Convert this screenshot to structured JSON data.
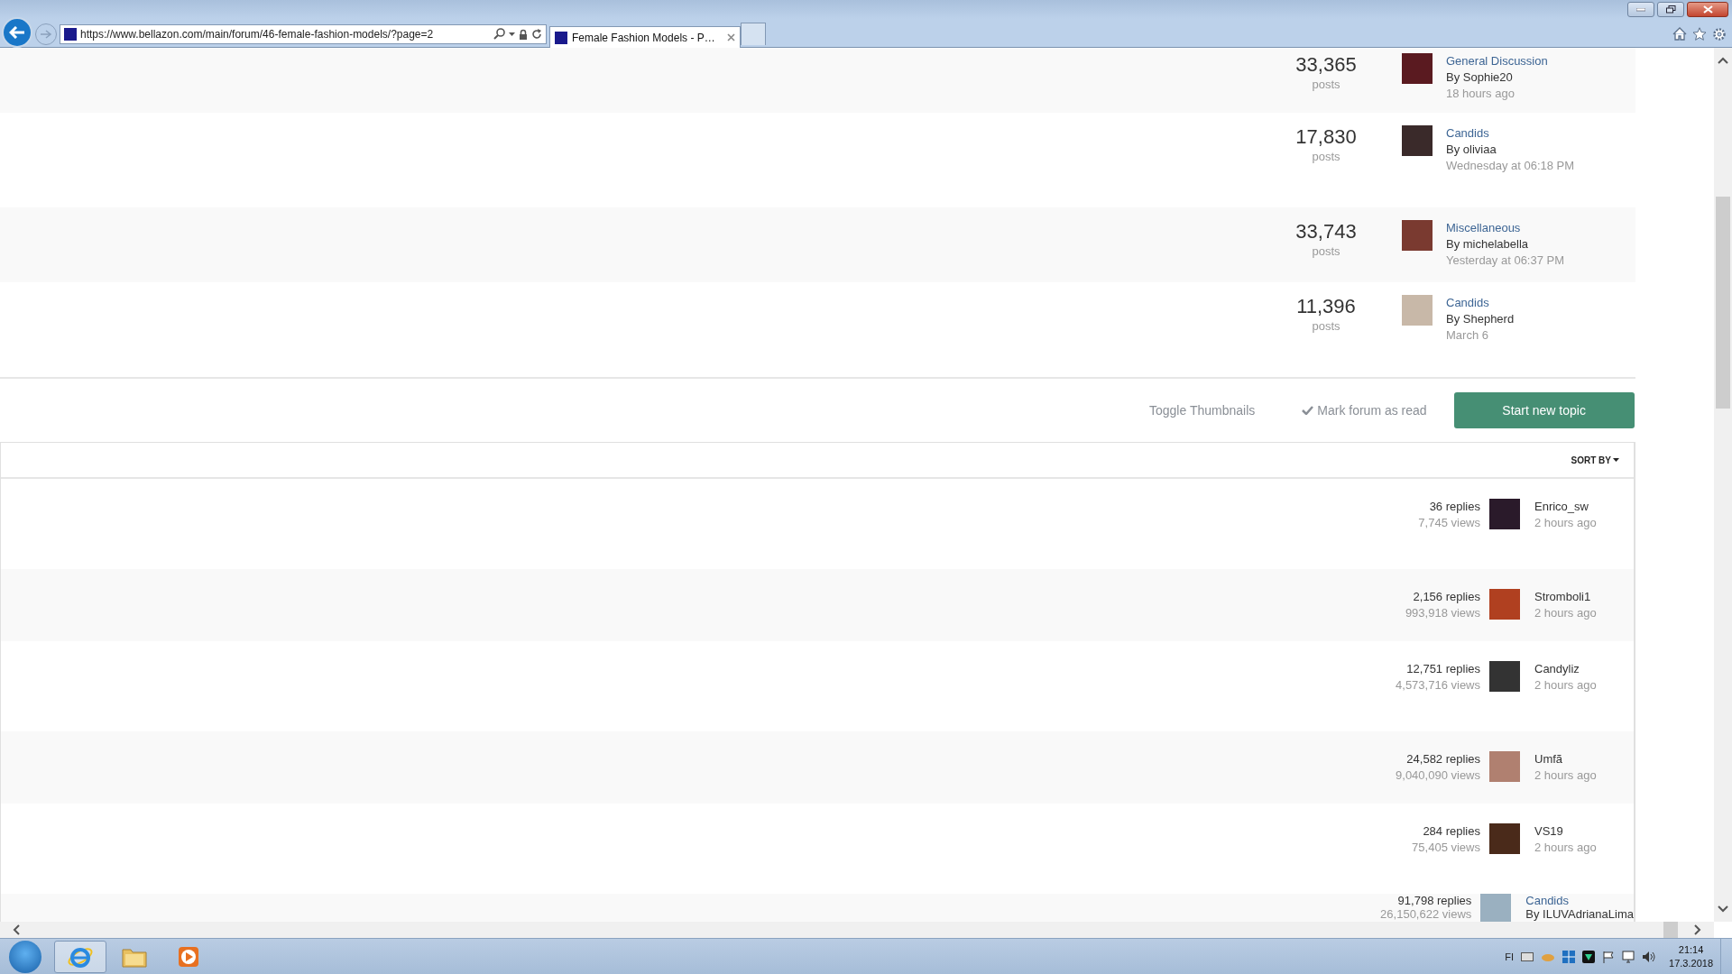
{
  "browser": {
    "url": "https://www.bellazon.com/main/forum/46-female-fashion-models/?page=2",
    "tabs": [
      {
        "title": "Female Fashion Models - P…",
        "selected": true
      }
    ]
  },
  "forums": [
    {
      "posts": "33,365",
      "posts_label": "posts",
      "forum": "General Discussion",
      "by": "By Sophie20",
      "time": "18 hours ago"
    },
    {
      "posts": "17,830",
      "posts_label": "posts",
      "forum": "Candids",
      "by": "By oliviaa",
      "time": "Wednesday at 06:18 PM"
    },
    {
      "posts": "33,743",
      "posts_label": "posts",
      "forum": "Miscellaneous",
      "by": "By michelabella",
      "time": "Yesterday at 06:37 PM"
    },
    {
      "posts": "11,396",
      "posts_label": "posts",
      "forum": "Candids",
      "by": "By Shepherd",
      "time": "March 6"
    }
  ],
  "actions": {
    "toggle_thumbnails": "Toggle Thumbnails",
    "mark_read": "Mark forum as read",
    "start_topic": "Start new topic"
  },
  "sort_by": "SORT BY",
  "topics": [
    {
      "kind": "user",
      "replies": "36 replies",
      "views": "7,745 views",
      "line_1": "Enrico_sw",
      "line_2": "2 hours ago"
    },
    {
      "kind": "user",
      "replies": "2,156 replies",
      "views": "993,918 views",
      "line_1": "Stromboli1",
      "line_2": "2 hours ago"
    },
    {
      "kind": "user",
      "replies": "12,751 replies",
      "views": "4,573,716 views",
      "line_1": "Candyliz",
      "line_2": "2 hours ago"
    },
    {
      "kind": "user",
      "replies": "24,582 replies",
      "views": "9,040,090 views",
      "line_1": "Umfã",
      "line_2": "2 hours ago"
    },
    {
      "kind": "user",
      "replies": "284 replies",
      "views": "75,405 views",
      "line_1": "VS19",
      "line_2": "2 hours ago"
    },
    {
      "kind": "forum",
      "replies": "91,798 replies",
      "views": "26,150,622 views",
      "line_1": "Candids",
      "line_2": "By ILUVAdrianaLima"
    }
  ],
  "taskbar": {
    "language": "FI",
    "time": "21:14",
    "date": "17.3.2018"
  }
}
